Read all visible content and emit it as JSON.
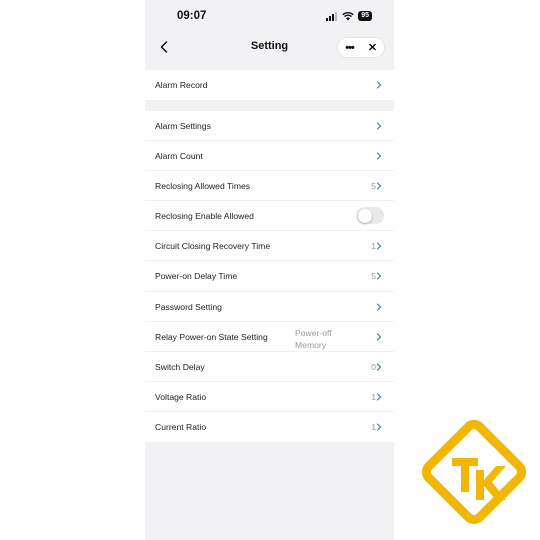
{
  "status_bar": {
    "time": "09:07",
    "battery": "95"
  },
  "nav": {
    "title": "Setting"
  },
  "group1": [
    {
      "label": "Alarm Record",
      "value": ""
    }
  ],
  "group2": [
    {
      "label": "Alarm Settings",
      "value": ""
    },
    {
      "label": "Alarm Count",
      "value": ""
    },
    {
      "label": "Reclosing Allowed Times",
      "value": "5"
    },
    {
      "label": "Reclosing Enable Allowed",
      "toggle": false
    },
    {
      "label": "Circuit Closing Recovery Time",
      "value": "1"
    },
    {
      "label": "Power-on Delay Time",
      "value": "5"
    },
    {
      "label": "Password Setting",
      "value": ""
    },
    {
      "label": "Relay Power-on State Setting",
      "value_line1": "Power-off",
      "value_line2": "Memory"
    },
    {
      "label": "Switch Delay",
      "value": "0"
    },
    {
      "label": "Voltage Ratio",
      "value": "1"
    },
    {
      "label": "Current Ratio",
      "value": "1"
    }
  ],
  "colors": {
    "chevron": "#2a8a9e",
    "background": "#f2f2f4",
    "watermark": "#f2b705"
  },
  "icons": [
    "back-arrow-icon",
    "more-icon",
    "close-icon",
    "chevron-right-icon",
    "signal-icon",
    "wifi-icon",
    "battery-icon",
    "logo-watermark-icon"
  ]
}
